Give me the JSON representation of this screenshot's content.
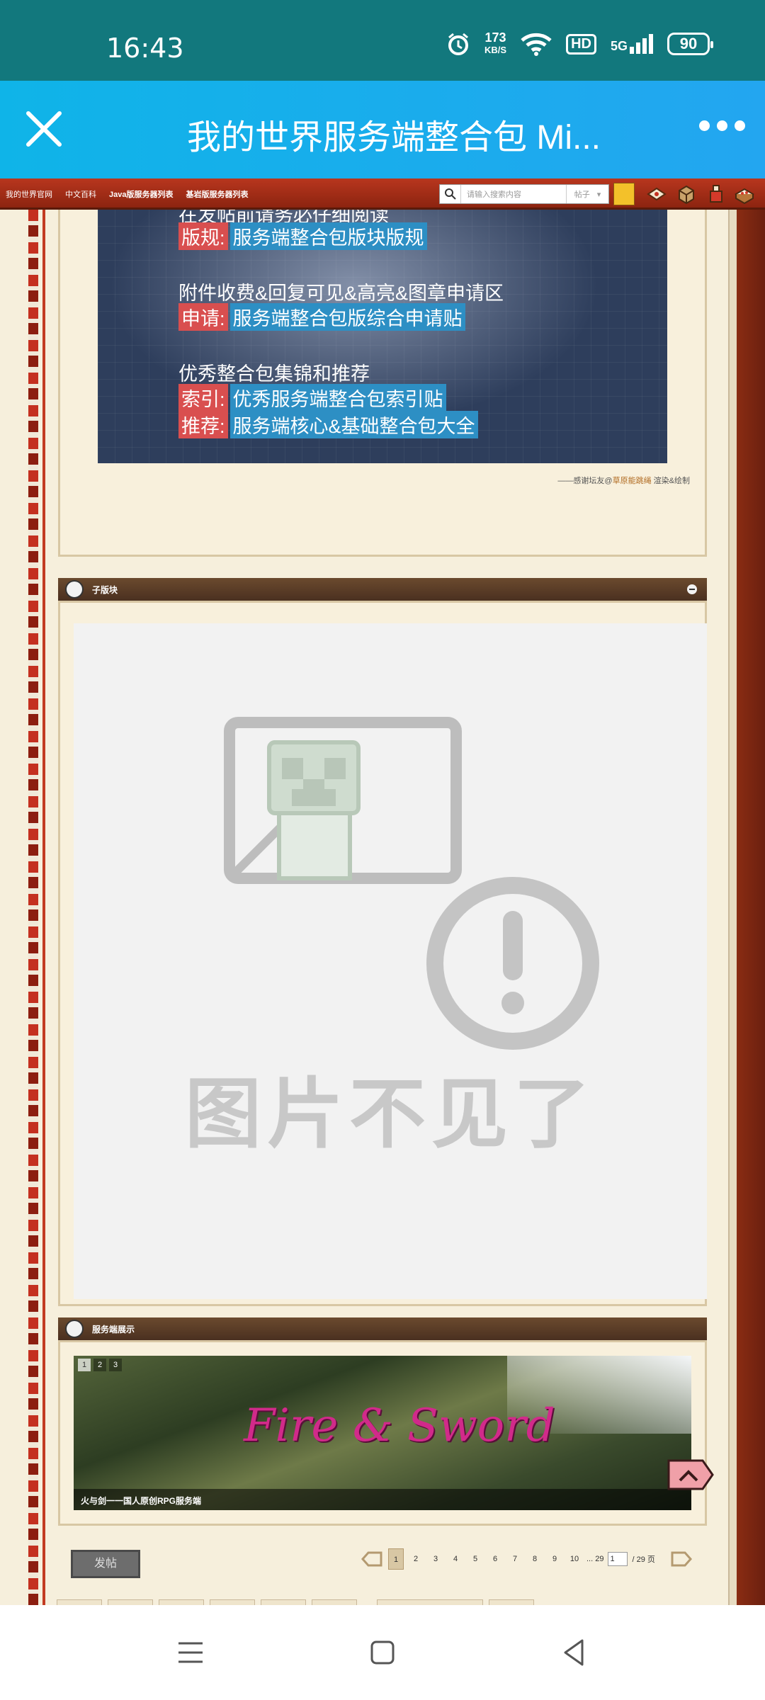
{
  "status_bar": {
    "time": "16:43",
    "net_speed_value": "173",
    "net_speed_unit": "KB/S",
    "hd": "HD",
    "network": "5G",
    "battery": "90"
  },
  "app_bar": {
    "title": "我的世界服务端整合包 Mi..."
  },
  "forum_nav": {
    "links": [
      "我的世界官网",
      "中文百科",
      "Java版服务器列表",
      "基岩版服务器列表"
    ],
    "search_placeholder": "请输入搜索内容",
    "search_type": "帖子"
  },
  "rules_banner": {
    "partial_top": "在发帖前请务必仔细阅读",
    "rules": {
      "tag": "版规:",
      "value": "服务端整合包版块版规"
    },
    "section2": "附件收费&回复可见&高亮&图章申请区",
    "apply": {
      "tag": "申请:",
      "value": "服务端整合包版综合申请贴"
    },
    "section3": "优秀整合包集锦和推荐",
    "index": {
      "tag": "索引:",
      "value": "优秀服务端整合包索引贴"
    },
    "recommend": {
      "tag": "推荐:",
      "value": "服务端核心&基础整合包大全"
    }
  },
  "credit": {
    "prefix": "——感谢坛友@",
    "author": "草原能跳绳",
    "suffix": " 渲染&绘制"
  },
  "subforum": {
    "title": "子版块",
    "missing_image_text": "图片不见了"
  },
  "showcase": {
    "title": "服务端展示",
    "slides": [
      "1",
      "2",
      "3"
    ],
    "current_slide": "1",
    "image_text": "Fire & Sword",
    "caption": "火与剑一一国人原创RPG服务端"
  },
  "pagination": {
    "post_button": "发帖",
    "pages": [
      "1",
      "2",
      "3",
      "4",
      "5",
      "6",
      "7",
      "8",
      "9",
      "10"
    ],
    "current_page": "1",
    "last_page": "... 29",
    "page_input": "1",
    "total": "/ 29 页"
  }
}
